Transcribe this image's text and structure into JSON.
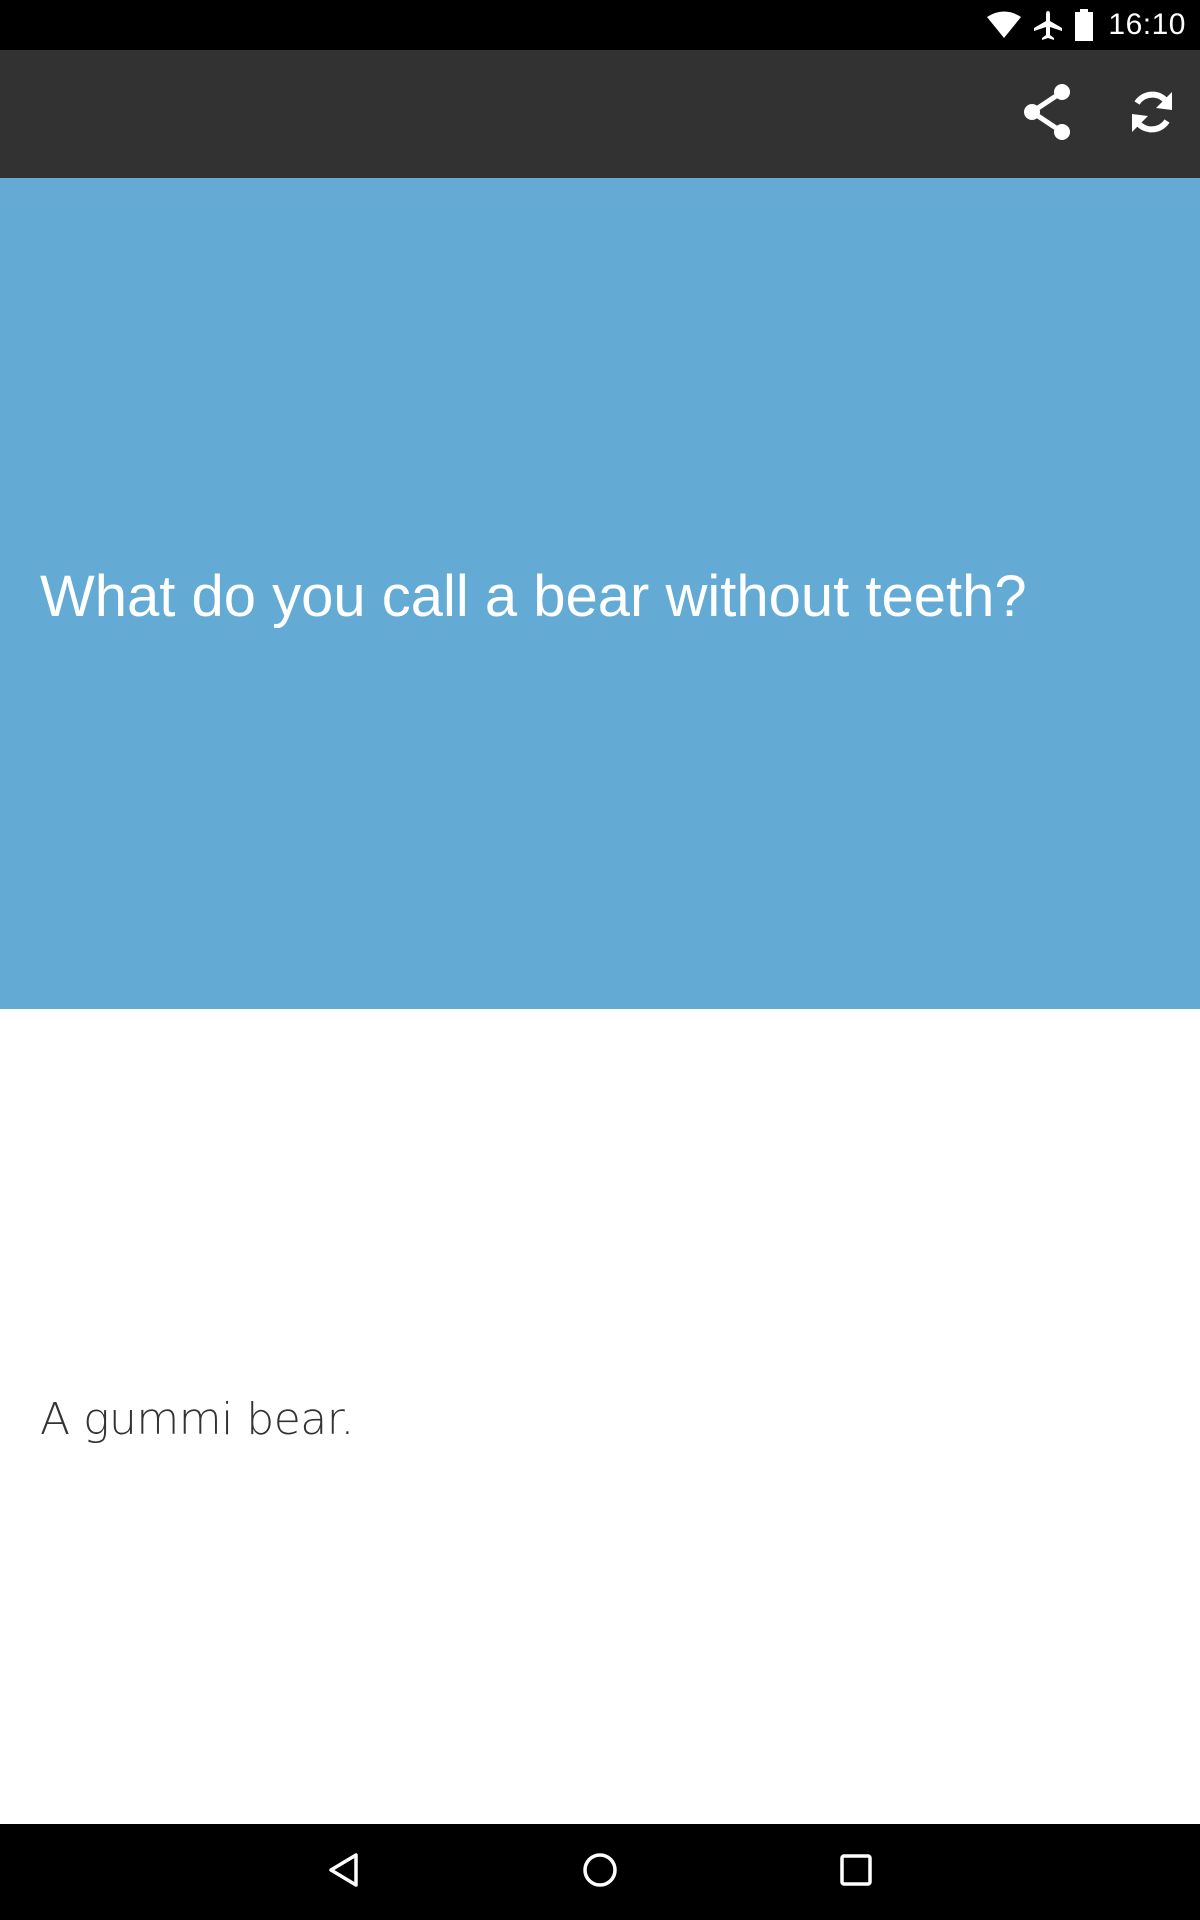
{
  "status_bar": {
    "time": "16:10",
    "icons": [
      "wifi-icon",
      "airplane-mode-icon",
      "battery-icon"
    ]
  },
  "toolbar": {
    "actions": [
      {
        "name": "share",
        "icon": "share-icon"
      },
      {
        "name": "refresh",
        "icon": "refresh-icon"
      }
    ]
  },
  "joke": {
    "question": "What do you call a bear without teeth?",
    "answer": "A gummi bear."
  },
  "colors": {
    "toolbar_background": "#323232",
    "question_background": "#63abd4",
    "answer_background": "#ffffff",
    "question_text": "#ffffff",
    "answer_text": "#333333"
  },
  "nav_bar": {
    "buttons": [
      "back-icon",
      "home-icon",
      "recents-icon"
    ]
  }
}
